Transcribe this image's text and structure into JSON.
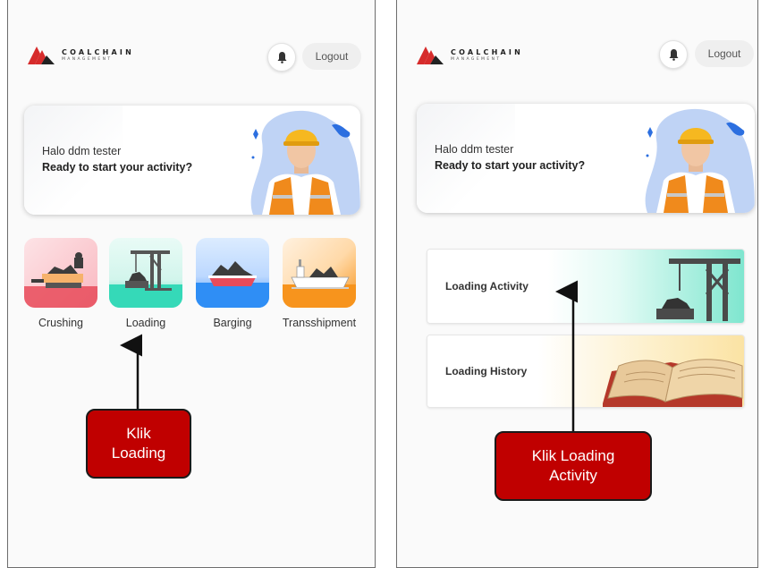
{
  "app": {
    "logo_brand": "COALCHAIN",
    "logo_sub": "MANAGEMENT"
  },
  "header": {
    "logout_label": "Logout",
    "bell_icon": "bell-icon"
  },
  "welcome": {
    "greeting": "Halo ddm tester",
    "prompt": "Ready to start your activity?"
  },
  "menu": [
    {
      "label": "Crushing",
      "icon": "crusher-icon"
    },
    {
      "label": "Loading",
      "icon": "crane-icon"
    },
    {
      "label": "Barging",
      "icon": "barge-icon"
    },
    {
      "label": "Transshipment",
      "icon": "ship-icon"
    }
  ],
  "loading_menu": [
    {
      "label": "Loading Activity",
      "icon": "crane-icon"
    },
    {
      "label": "Loading History",
      "icon": "book-icon"
    }
  ],
  "annotations": {
    "left": [
      "Klik",
      "Loading"
    ],
    "right": [
      "Klik Loading",
      "Activity"
    ]
  },
  "colors": {
    "callout": "#c00000",
    "logo_red": "#d62b2b",
    "crane": "#555555"
  }
}
